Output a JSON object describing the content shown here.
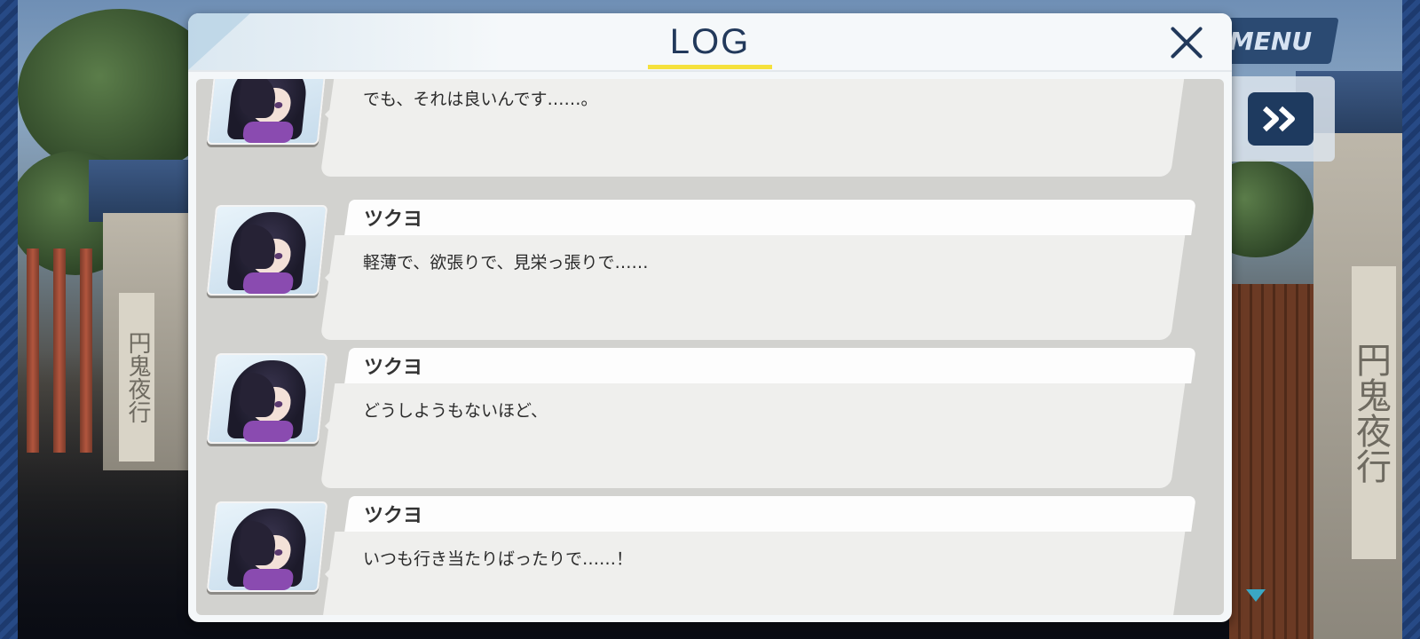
{
  "background": {
    "sign_text": "円鬼夜行"
  },
  "hud": {
    "menu_label": "MENU",
    "fast_forward_icon": "double-chevron-right-icon",
    "scroll_down_icon": "triangle-down-icon"
  },
  "log": {
    "title": "LOG",
    "close_icon": "close-x-icon",
    "accent_color": "#f5e13c",
    "entries": [
      {
        "speaker": "",
        "text": "でも、それは良いんです……。"
      },
      {
        "speaker": "ツクヨ",
        "text": "軽薄で、欲張りで、見栄っ張りで……"
      },
      {
        "speaker": "ツクヨ",
        "text": "どうしようもないほど、"
      },
      {
        "speaker": "ツクヨ",
        "text": "いつも行き当たりばったりで……！"
      }
    ]
  }
}
